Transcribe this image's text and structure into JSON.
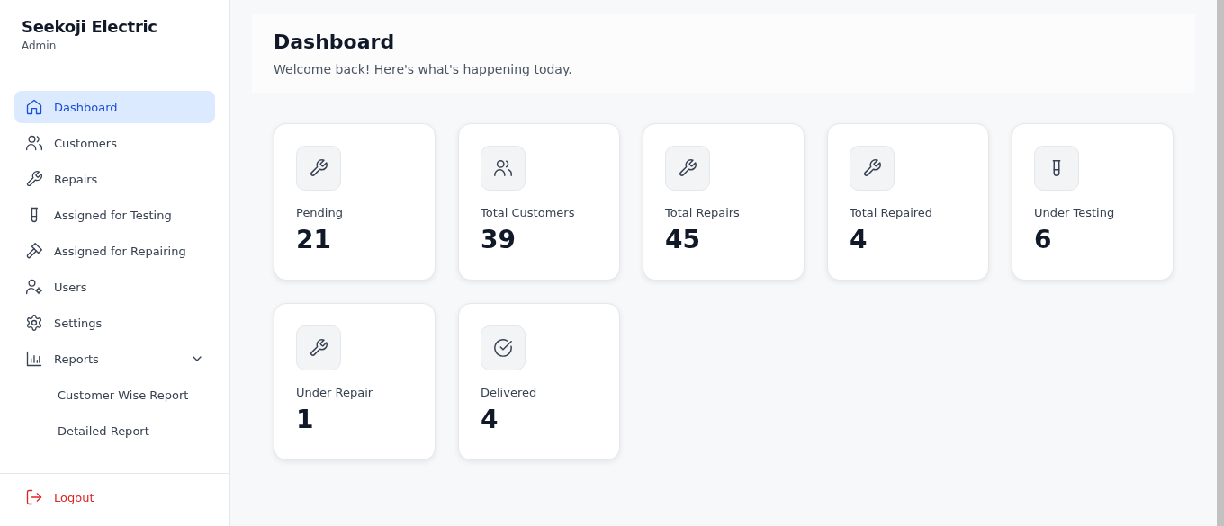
{
  "brand": {
    "title": "Seekoji Electric",
    "role": "Admin"
  },
  "sidebar": {
    "items": [
      {
        "label": "Dashboard",
        "selected": true
      },
      {
        "label": "Customers",
        "selected": false
      },
      {
        "label": "Repairs",
        "selected": false
      },
      {
        "label": "Assigned for Testing",
        "selected": false
      },
      {
        "label": "Assigned for Repairing",
        "selected": false
      },
      {
        "label": "Users",
        "selected": false
      },
      {
        "label": "Settings",
        "selected": false
      },
      {
        "label": "Reports",
        "selected": false,
        "expanded": true,
        "children": [
          {
            "label": "Customer Wise Report",
            "selected": false
          },
          {
            "label": "Detailed Report",
            "selected": false
          }
        ]
      }
    ],
    "logout": "Logout"
  },
  "header": {
    "title": "Dashboard",
    "subtitle": "Welcome back! Here's what's happening today."
  },
  "cards": [
    {
      "label": "Pending",
      "value": "21"
    },
    {
      "label": "Total Customers",
      "value": "39"
    },
    {
      "label": "Total Repairs",
      "value": "45"
    },
    {
      "label": "Total Repaired",
      "value": "4"
    },
    {
      "label": "Under Testing",
      "value": "6"
    },
    {
      "label": "Under Repair",
      "value": "1"
    },
    {
      "label": "Delivered",
      "value": "4"
    }
  ]
}
